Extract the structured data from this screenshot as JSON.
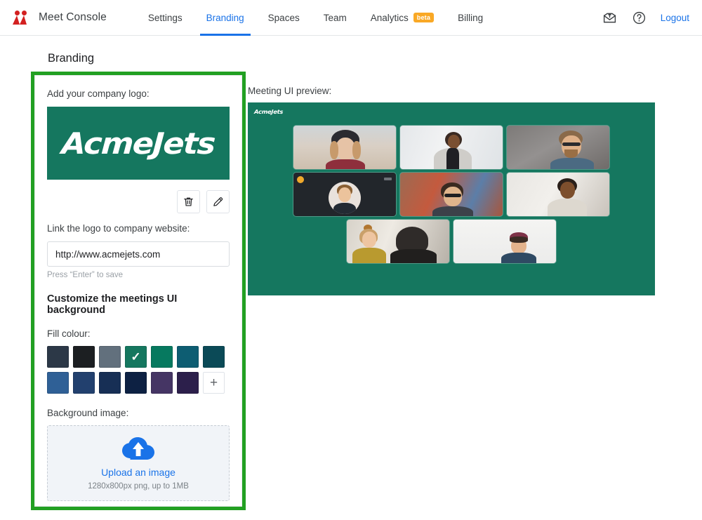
{
  "header": {
    "brand_title": "Meet Console",
    "brand_logo_icon": "meet-console-logo-icon",
    "nav": [
      {
        "label": "Settings",
        "active": false,
        "badge": null
      },
      {
        "label": "Branding",
        "active": true,
        "badge": null
      },
      {
        "label": "Spaces",
        "active": false,
        "badge": null
      },
      {
        "label": "Team",
        "active": false,
        "badge": null
      },
      {
        "label": "Analytics",
        "active": false,
        "badge": "beta"
      },
      {
        "label": "Billing",
        "active": false,
        "badge": null
      }
    ],
    "mail_icon": "envelope-upload-icon",
    "help_icon": "question-mark-circle-icon",
    "logout_label": "Logout",
    "accent_color": "#1a73e8",
    "beta_badge_color": "#f9a825"
  },
  "page": {
    "title": "Branding"
  },
  "branding_panel": {
    "highlight_color": "#22a022",
    "logo_section_label": "Add your company logo:",
    "logo_text": "AcmeJets",
    "logo_background": "#15775f",
    "delete_icon": "trash-icon",
    "edit_icon": "pencil-icon",
    "link_label": "Link the logo to company website:",
    "link_value": "http://www.acmejets.com",
    "link_placeholder": "http://",
    "save_hint": "Press “Enter” to save",
    "customize_heading": "Customize the meetings UI background",
    "fill_colour_label": "Fill colour:",
    "swatches": [
      {
        "color": "#2c3847",
        "selected": false
      },
      {
        "color": "#1c1f22",
        "selected": false
      },
      {
        "color": "#62707d",
        "selected": false
      },
      {
        "color": "#15775f",
        "selected": true
      },
      {
        "color": "#06795f",
        "selected": false
      },
      {
        "color": "#0d5d72",
        "selected": false
      },
      {
        "color": "#0b4a57",
        "selected": false
      },
      {
        "color": "#2f6096",
        "selected": false
      },
      {
        "color": "#22406e",
        "selected": false
      },
      {
        "color": "#172f55",
        "selected": false
      },
      {
        "color": "#0d2143",
        "selected": false
      },
      {
        "color": "#453564",
        "selected": false
      },
      {
        "color": "#2c1f4b",
        "selected": false
      }
    ],
    "add_swatch_icon": "plus-icon",
    "selected_check_icon": "check-icon",
    "background_image_label": "Background image:",
    "upload_icon": "cloud-upload-icon",
    "upload_link": "Upload an image",
    "upload_hint": "1280x800px png, up to 1MB"
  },
  "preview": {
    "label": "Meeting UI preview:",
    "background_color": "#15775f",
    "logo_text": "AcmeJets",
    "tiles": [
      {
        "id": "tile-1",
        "kind": "video",
        "participant": "woman-with-hat"
      },
      {
        "id": "tile-2",
        "kind": "video",
        "participant": "smiling-woman-blazer"
      },
      {
        "id": "tile-3",
        "kind": "video",
        "participant": "bearded-man-glasses"
      },
      {
        "id": "tile-4",
        "kind": "avatar",
        "participant": "man-avatar-camera-off"
      },
      {
        "id": "tile-5",
        "kind": "video",
        "participant": "man-glasses-brick-wall"
      },
      {
        "id": "tile-6",
        "kind": "video",
        "participant": "smiling-man-office"
      },
      {
        "id": "tile-7",
        "kind": "video",
        "participant": "woman-laughing-yellow"
      },
      {
        "id": "tile-8",
        "kind": "video",
        "participant": "man-beanie-whiteboard"
      }
    ]
  }
}
